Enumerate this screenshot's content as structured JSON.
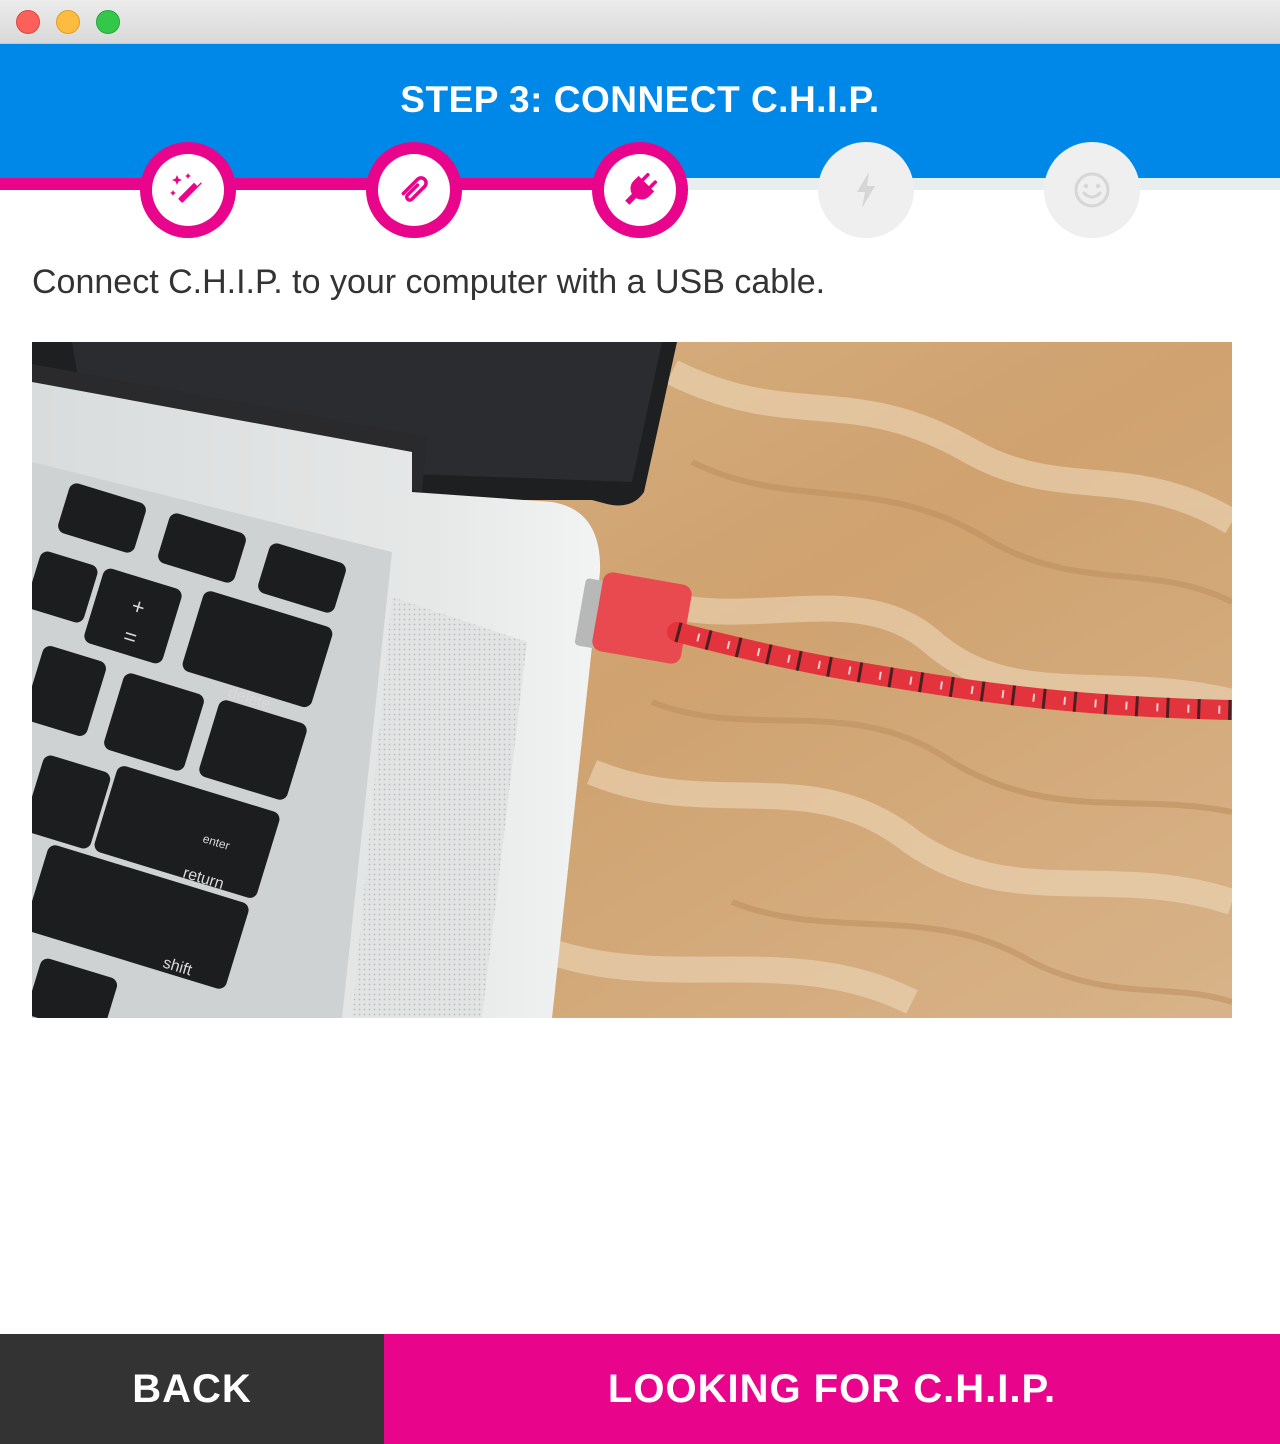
{
  "window": {
    "buttons": [
      "close-button",
      "minimize-button",
      "maximize-button"
    ]
  },
  "header": {
    "title": "STEP 3: CONNECT C.H.I.P."
  },
  "steps": [
    {
      "icon": "magic-wand-icon",
      "state": "complete"
    },
    {
      "icon": "paperclip-icon",
      "state": "complete"
    },
    {
      "icon": "plug-icon",
      "state": "current"
    },
    {
      "icon": "lightning-bolt-icon",
      "state": "pending"
    },
    {
      "icon": "smiley-icon",
      "state": "pending"
    }
  ],
  "progress": {
    "completed_steps": 3,
    "total_steps": 5
  },
  "main": {
    "instruction": "Connect C.H.I.P. to your computer with a USB cable.",
    "photo": "laptop-usb-cable-photo"
  },
  "footer": {
    "back_label": "BACK",
    "status_label": "LOOKING FOR C.H.I.P."
  },
  "colors": {
    "header_blue": "#0088e8",
    "accent_pink": "#e8058c",
    "back_dark": "#333333"
  }
}
